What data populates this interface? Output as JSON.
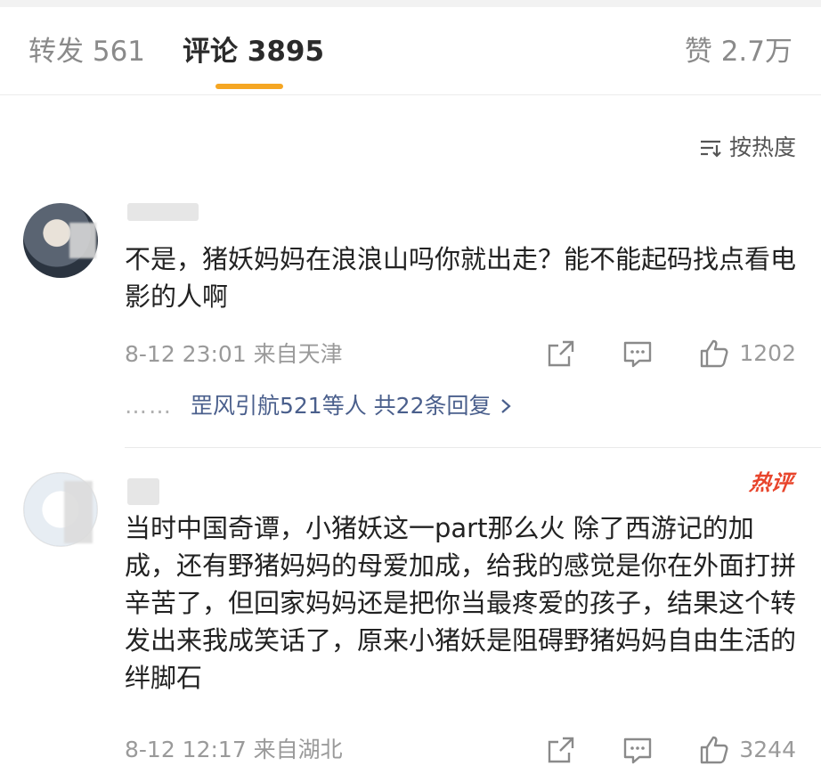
{
  "tabs": {
    "reposts_label": "转发 561",
    "comments_label": "评论 3895",
    "likes_label": "赞 2.7万"
  },
  "sort": {
    "label": "按热度",
    "icon": "sort-icon"
  },
  "comments": [
    {
      "text": "不是，猪妖妈妈在浪浪山吗你就出走？能不能起码找点看电影的人啊",
      "meta": "8-12 23:01  来自天津",
      "like_count": "1202",
      "replies_label": "罡风引航521等人 共22条回复",
      "dots": "……"
    },
    {
      "badge": "热评",
      "text": "当时中国奇谭，小猪妖这一part那么火 除了西游记的加成，还有野猪妈妈的母爱加成，给我的感觉是你在外面打拼辛苦了，但回家妈妈还是把你当最疼爱的孩子，结果这个转发出来我成笑话了，原来小猪妖是阻碍野猪妈妈自由生活的绊脚石",
      "meta": "8-12 12:17  来自湖北",
      "like_count": "3244"
    }
  ],
  "colors": {
    "accent": "#f5a623",
    "link": "#4a5f8c",
    "hot": "#e8452c"
  }
}
